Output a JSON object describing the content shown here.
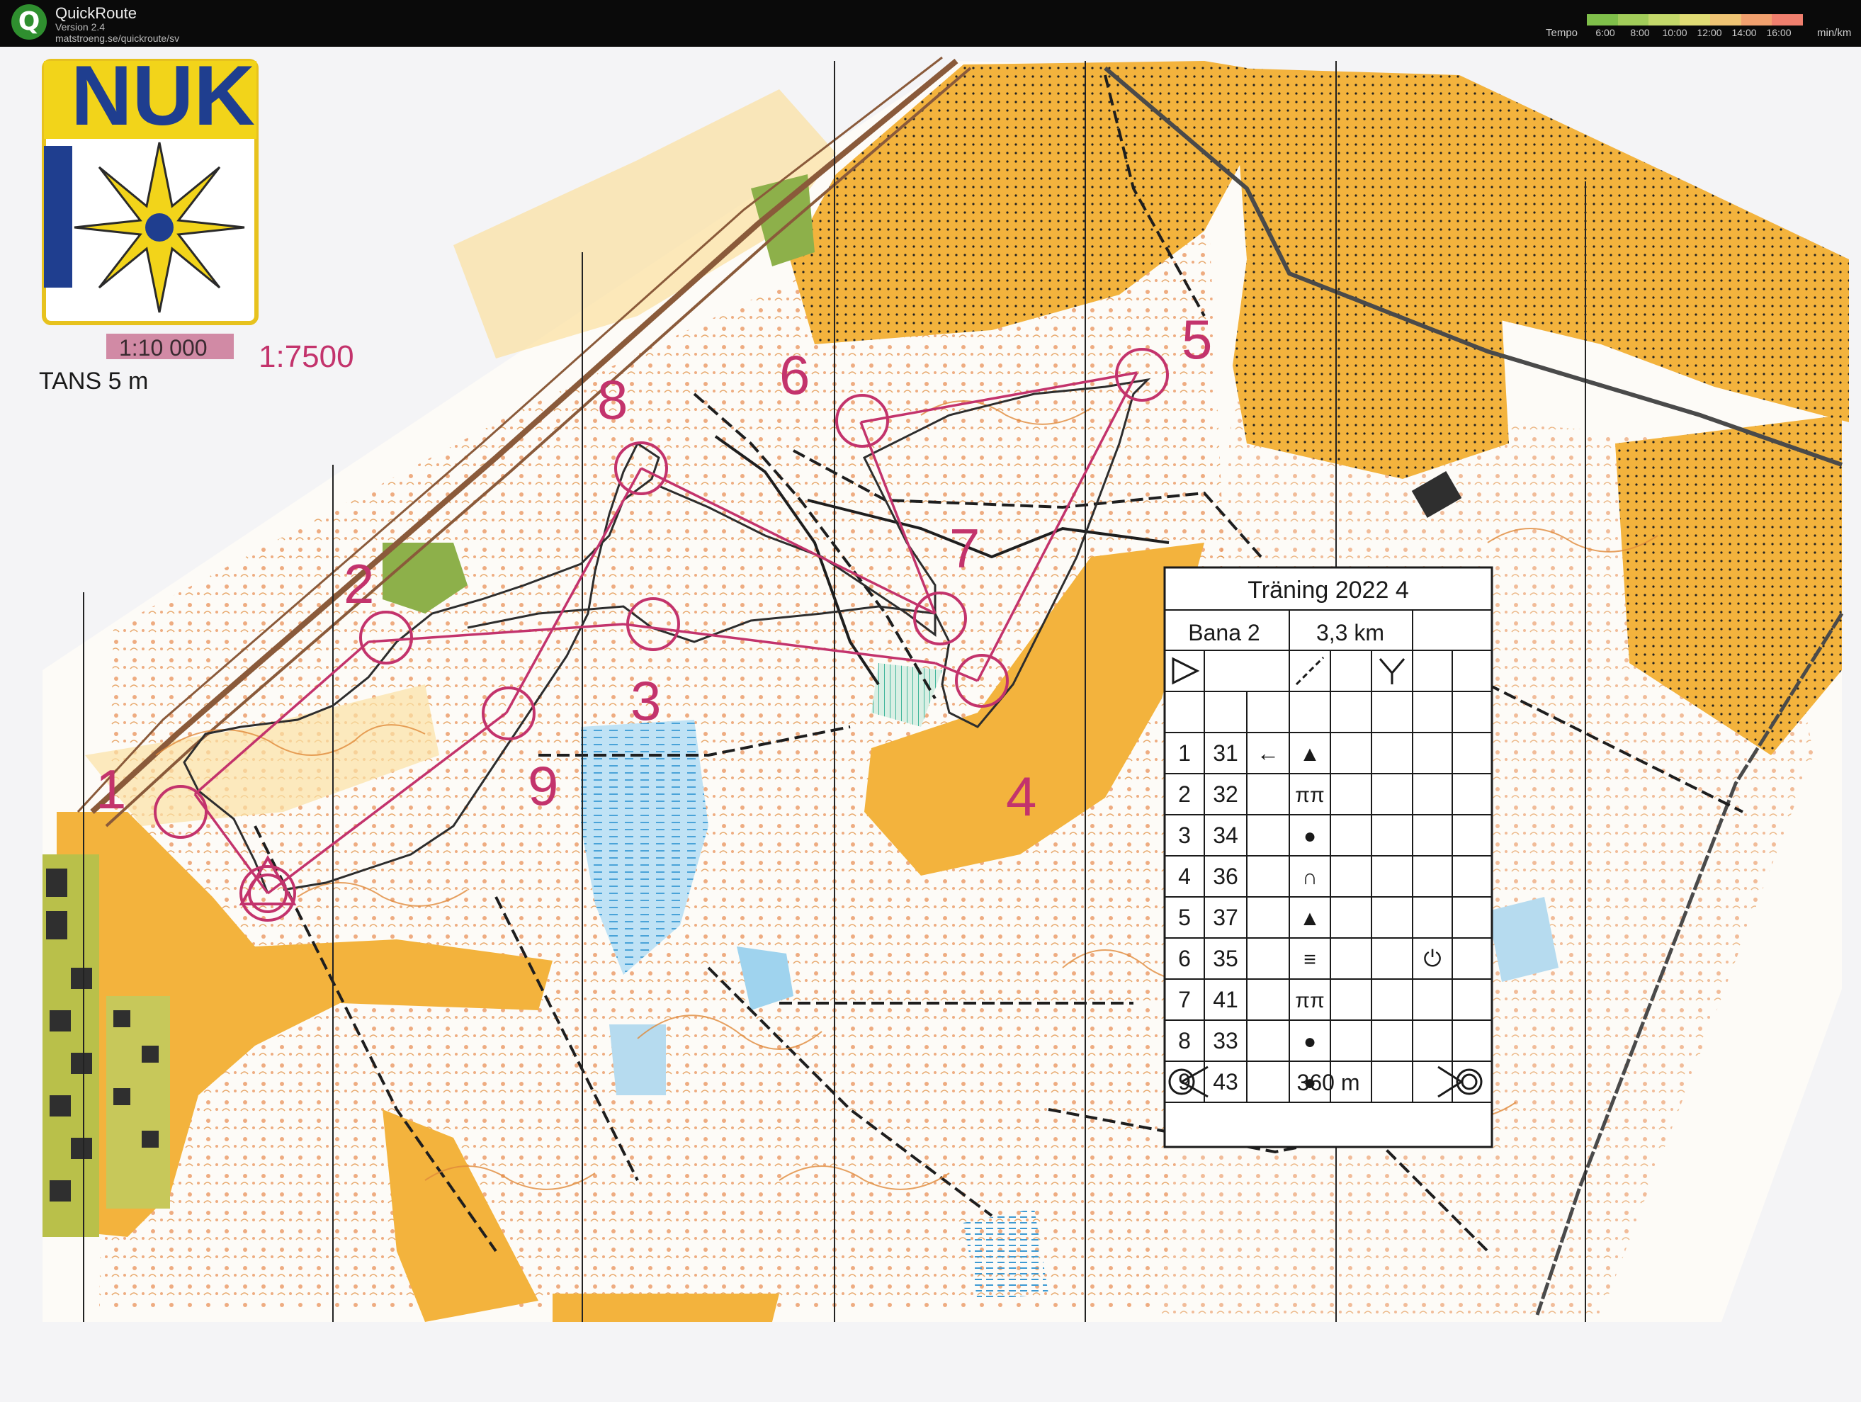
{
  "app": {
    "title": "QuickRoute",
    "version": "Version 2.4",
    "url": "matstroeng.se/quickroute/sv"
  },
  "tempo_legend": {
    "label": "Tempo",
    "ticks": [
      "6:00",
      "8:00",
      "10:00",
      "12:00",
      "14:00",
      "16:00"
    ],
    "unit": "min/km",
    "colors": [
      "#7fbf4a",
      "#a2cc5a",
      "#c3d86a",
      "#e0dc74",
      "#efc474",
      "#f1a06e",
      "#ef7f6e"
    ]
  },
  "map": {
    "scale_old": "1:10 000",
    "scale_new": "1:7500",
    "contour_text": "TANS  5 m",
    "colors": {
      "open_land": "#f3b33d",
      "rough_open": "#fbd98a",
      "water": "#9fd3ee",
      "course": "#c3336c",
      "route": "#2d2d2d",
      "contour": "#e08a3a",
      "track": "#1e1e1e",
      "green": "#8db04a",
      "building": "#2f2f2f"
    },
    "controls": [
      {
        "label": "1"
      },
      {
        "label": "2"
      },
      {
        "label": "3"
      },
      {
        "label": "4"
      },
      {
        "label": "5"
      },
      {
        "label": "6"
      },
      {
        "label": "7"
      },
      {
        "label": "8"
      },
      {
        "label": "9"
      }
    ]
  },
  "description_sheet": {
    "title": "Träning 2022 4",
    "course": "Bana 2",
    "length": "3,3 km",
    "rows": [
      {
        "num": "1",
        "code": "31",
        "direction": "←",
        "feature": "▲",
        "appearance": ""
      },
      {
        "num": "2",
        "code": "32",
        "direction": "",
        "feature": "ππ",
        "appearance": ""
      },
      {
        "num": "3",
        "code": "34",
        "direction": "",
        "feature": "●",
        "appearance": ""
      },
      {
        "num": "4",
        "code": "36",
        "direction": "",
        "feature": "∩",
        "appearance": ""
      },
      {
        "num": "5",
        "code": "37",
        "direction": "",
        "feature": "▲",
        "appearance": ""
      },
      {
        "num": "6",
        "code": "35",
        "direction": "",
        "feature": "≡",
        "appearance": "⏻"
      },
      {
        "num": "7",
        "code": "41",
        "direction": "",
        "feature": "ππ",
        "appearance": ""
      },
      {
        "num": "8",
        "code": "33",
        "direction": "",
        "feature": "●",
        "appearance": ""
      },
      {
        "num": "9",
        "code": "43",
        "direction": "",
        "feature": "●",
        "appearance": ""
      }
    ],
    "finish_distance": "360 m"
  }
}
